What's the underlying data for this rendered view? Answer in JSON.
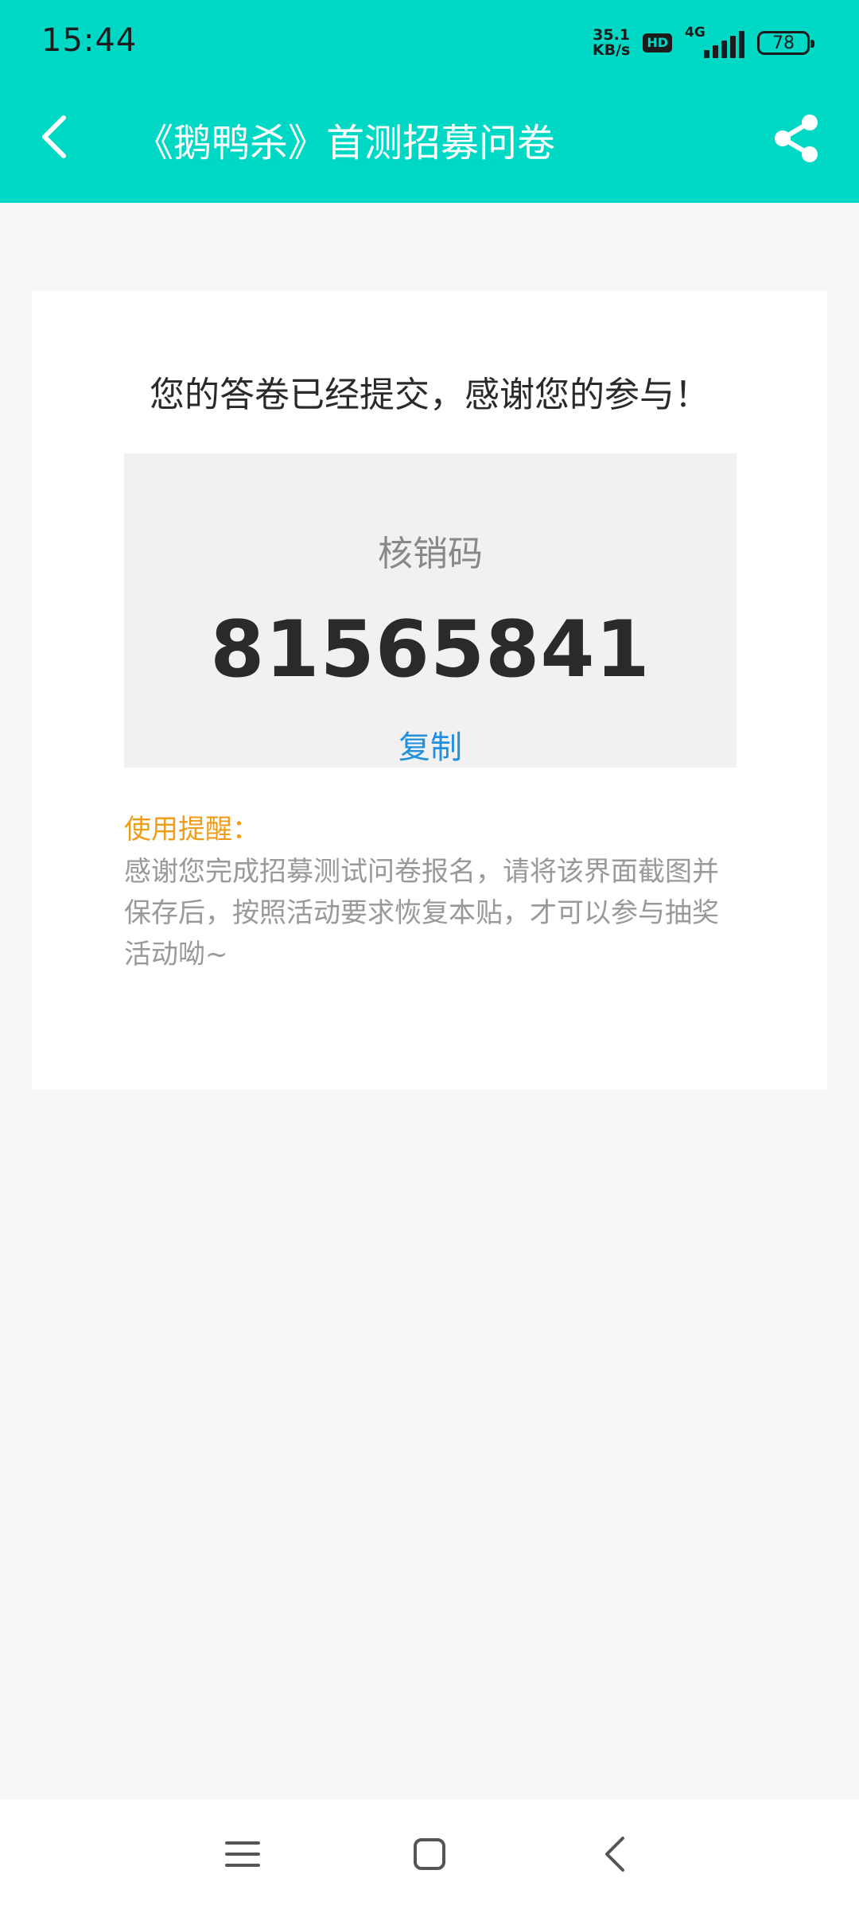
{
  "status_bar": {
    "time": "15:44",
    "net_speed_value": "35.1",
    "net_speed_unit": "KB/s",
    "hd_badge": "HD",
    "network": "4G",
    "battery": "78"
  },
  "header": {
    "title": "《鹅鸭杀》首测招募问卷",
    "back_icon": "back-arrow-icon",
    "share_icon": "share-icon",
    "background_color": "#00d8c6"
  },
  "card": {
    "success_message": "您的答卷已经提交，感谢您的参与！",
    "code_label": "核销码",
    "code_value": "81565841",
    "copy_label": "复制",
    "tip_title": "使用提醒：",
    "tip_lines": [
      "感谢您完成招募测试问卷报名，请将该界面截图并",
      "保存后，按照活动要求恢复本贴，才可以参与抽奖",
      "活动呦~"
    ]
  },
  "navigation_bar": {
    "menu_icon": "menu-icon",
    "home_icon": "home-icon",
    "back_icon": "back-icon"
  },
  "colors": {
    "accent": "#00d8c6",
    "link": "#1f8fe0",
    "tip_title": "#f09c18"
  }
}
